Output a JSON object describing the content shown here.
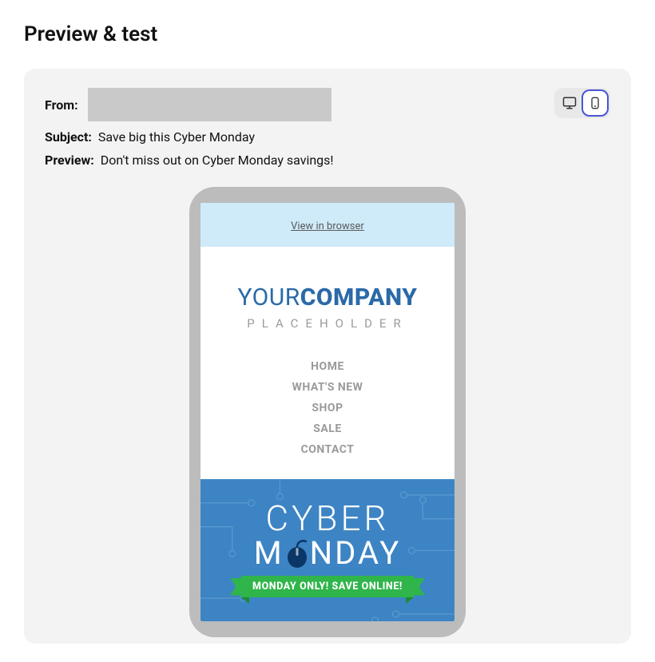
{
  "page": {
    "title": "Preview & test"
  },
  "meta": {
    "from_label": "From:",
    "subject_label": "Subject:",
    "subject_value": "Save big this Cyber Monday",
    "preview_label": "Preview:",
    "preview_value": "Don't miss out on Cyber Monday savings!"
  },
  "email": {
    "view_in_browser": "View in browser",
    "logo_thin": "YOUR",
    "logo_bold": "COMPANY",
    "logo_sub": "PLACEHOLDER",
    "nav": [
      "HOME",
      "WHAT'S NEW",
      "SHOP",
      "SALE",
      "CONTACT"
    ],
    "banner_top": "CYBER",
    "banner_bottom_left": "M",
    "banner_bottom_right": "NDAY",
    "ribbon": "MONDAY ONLY! SAVE ONLINE!"
  }
}
